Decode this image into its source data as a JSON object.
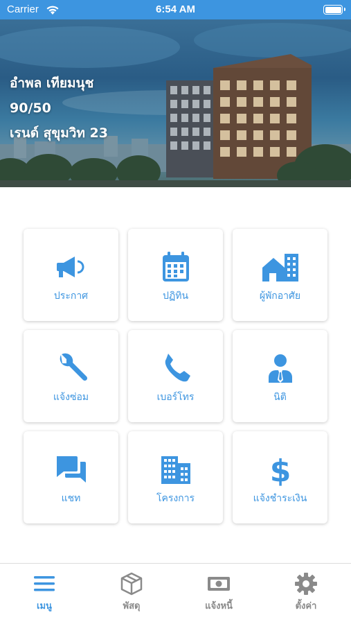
{
  "status_bar": {
    "carrier": "Carrier",
    "time": "6:54 AM"
  },
  "hero": {
    "lines": [
      "อำพล เทียมนุช",
      "90/50",
      "เรนด์ สุขุมวิท 23"
    ]
  },
  "menu": {
    "items": [
      {
        "label": "ประกาศ",
        "icon": "megaphone-icon"
      },
      {
        "label": "ปฏิทิน",
        "icon": "calendar-icon"
      },
      {
        "label": "ผู้พักอาศัย",
        "icon": "residence-icon"
      },
      {
        "label": "แจ้งซ่อม",
        "icon": "wrench-icon"
      },
      {
        "label": "เบอร์โทร",
        "icon": "phone-icon"
      },
      {
        "label": "นิติ",
        "icon": "person-icon"
      },
      {
        "label": "แชท",
        "icon": "chat-icon"
      },
      {
        "label": "โครงการ",
        "icon": "building-icon"
      },
      {
        "label": "แจ้งชำระเงิน",
        "icon": "dollar-icon"
      }
    ]
  },
  "tabbar": {
    "tabs": [
      {
        "label": "เมนู",
        "icon": "menu-icon",
        "active": true
      },
      {
        "label": "พัสดุ",
        "icon": "box-icon",
        "active": false
      },
      {
        "label": "แจ้งหนี้",
        "icon": "bill-icon",
        "active": false
      },
      {
        "label": "ตั้งค่า",
        "icon": "gear-icon",
        "active": false
      }
    ]
  },
  "colors": {
    "accent": "#3d95e0",
    "inactive": "#8a8a8a"
  }
}
